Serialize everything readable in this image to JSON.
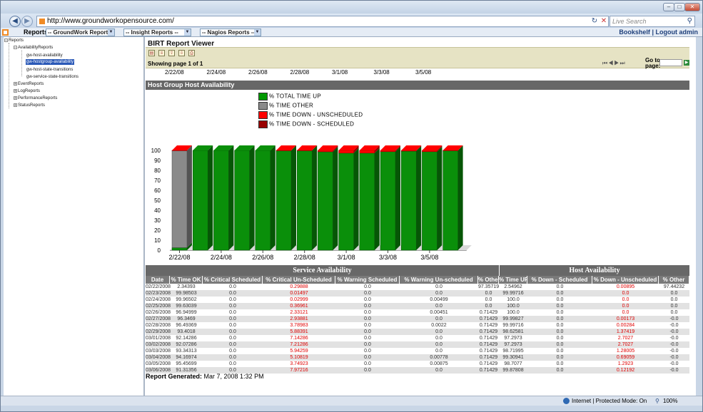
{
  "browser": {
    "url": "http://www.groundworkopensource.com/",
    "search_placeholder": "Live Search",
    "tab_label": "Reports",
    "selects": [
      "-- GroundWork Reports --",
      "-- Insight Reports --",
      "-- Nagios Reports --"
    ],
    "links": {
      "bookshelf": "Bookshelf",
      "separator": "|",
      "logout": "Logout admin"
    },
    "status": {
      "zone": "Internet | Protected Mode: On",
      "zoom": "100%"
    }
  },
  "tree": {
    "root": "Reports",
    "group": "AvailabilityReports",
    "items": [
      "gw-host-availability",
      "gw-hostgroup-availability",
      "gw-host-state-transitions",
      "gw-service-state-transitions"
    ],
    "others": [
      "EventReports",
      "LogReports",
      "PerformanceReports",
      "StatusReports"
    ]
  },
  "birt": {
    "title": "BIRT Report Viewer",
    "showing": "Showing page  1  of  1",
    "goto": "Go to page:"
  },
  "report": {
    "top_ticks": [
      "2/22/08",
      "2/24/08",
      "2/26/08",
      "2/28/08",
      "3/1/08",
      "3/3/08",
      "3/5/08"
    ],
    "section_title": "Host Group Host Availability",
    "legend": [
      {
        "label": "% TOTAL TIME UP",
        "color": "#009900"
      },
      {
        "label": "% TIME OTHER",
        "color": "#8a8a8a"
      },
      {
        "label": "% TIME DOWN - UNSCHEDULED",
        "color": "#ff0000"
      },
      {
        "label": "% TIME DOWN - SCHEDULED",
        "color": "#990000"
      }
    ],
    "generated_label": "Report Generated:",
    "generated_value": "Mar 7, 2008 1:32 PM"
  },
  "chart_data": {
    "type": "bar",
    "categories": [
      "2/22/08",
      "2/23/08",
      "2/24/08",
      "2/25/08",
      "2/26/08",
      "2/27/08",
      "2/28/08",
      "2/29/08",
      "3/1/08",
      "3/2/08",
      "3/3/08",
      "3/4/08",
      "3/5/08",
      "3/6/08"
    ],
    "tick_labels": [
      "2/22/08",
      "2/24/08",
      "2/26/08",
      "2/28/08",
      "3/1/08",
      "3/3/08",
      "3/5/08"
    ],
    "series": [
      {
        "name": "% TOTAL TIME UP",
        "color": "#0a8f0a",
        "values": [
          2.55,
          99.997,
          100,
          100,
          100,
          99.998,
          99.997,
          98.626,
          97.297,
          97.297,
          98.72,
          99.309,
          98.708,
          99.878
        ]
      },
      {
        "name": "% TIME OTHER",
        "color": "#8a8a8a",
        "values": [
          97.44,
          0,
          0,
          0,
          0,
          0,
          0,
          0,
          0,
          0,
          0,
          0,
          0,
          0
        ]
      },
      {
        "name": "% TIME DOWN - UNSCHEDULED",
        "color": "#ff0000",
        "values": [
          0.008,
          0,
          0,
          0,
          0,
          0.002,
          0.003,
          1.374,
          2.703,
          2.703,
          1.28,
          0.69,
          1.292,
          0.122
        ]
      },
      {
        "name": "% TIME DOWN - SCHEDULED",
        "color": "#990000",
        "values": [
          0,
          0,
          0,
          0,
          0,
          0,
          0,
          0,
          0,
          0,
          0,
          0,
          0,
          0
        ]
      }
    ],
    "yticks": [
      0,
      10,
      20,
      30,
      40,
      50,
      60,
      70,
      80,
      90,
      100
    ],
    "ylim": [
      0,
      100
    ],
    "stacked": true,
    "legend_position": "top",
    "grid": false
  },
  "table": {
    "group_headers": [
      "Service Availability",
      "Host Availability"
    ],
    "columns": [
      "Date",
      "% Time OK",
      "% Critical Scheduled",
      "% Critical Un-Scheduled",
      "% Warning Scheduled",
      "% Warning Un-scheduled",
      "% Other",
      "% Time UP",
      "% Down - Scheduled",
      "% Down - Unscheduled",
      "% Other"
    ],
    "rows": [
      [
        "02/22/2008",
        "2.34393",
        "0.0",
        "0.29888",
        "0.0",
        "0.0",
        "97.35719",
        "2.54962",
        "0.0",
        "0.00895",
        "97.44232"
      ],
      [
        "02/23/2008",
        "99.98503",
        "0.0",
        "0.01497",
        "0.0",
        "0.0",
        "0.0",
        "99.99716",
        "0.0",
        "0.0",
        "0.0"
      ],
      [
        "02/24/2008",
        "99.96502",
        "0.0",
        "0.02999",
        "0.0",
        "0.00499",
        "0.0",
        "100.0",
        "0.0",
        "0.0",
        "0.0"
      ],
      [
        "02/25/2008",
        "99.63039",
        "0.0",
        "0.36961",
        "0.0",
        "0.0",
        "0.0",
        "100.0",
        "0.0",
        "0.0",
        "0.0"
      ],
      [
        "02/26/2008",
        "96.94999",
        "0.0",
        "2.33121",
        "0.0",
        "0.00451",
        "0.71429",
        "100.0",
        "0.0",
        "0.0",
        "0.0"
      ],
      [
        "02/27/2008",
        "96.3469",
        "0.0",
        "2.93881",
        "0.0",
        "0.0",
        "0.71429",
        "99.99827",
        "0.0",
        "0.00173",
        "-0.0"
      ],
      [
        "02/28/2008",
        "96.49369",
        "0.0",
        "3.78983",
        "0.0",
        "0.0022",
        "0.71429",
        "99.99716",
        "0.0",
        "0.00284",
        "-0.0"
      ],
      [
        "02/29/2008",
        "93.4018",
        "0.0",
        "5.88391",
        "0.0",
        "0.0",
        "0.71429",
        "98.62581",
        "0.0",
        "1.37419",
        "-0.0"
      ],
      [
        "03/01/2008",
        "92.14286",
        "0.0",
        "7.14286",
        "0.0",
        "0.0",
        "0.71429",
        "97.2973",
        "0.0",
        "2.7027",
        "-0.0"
      ],
      [
        "03/02/2008",
        "92.07286",
        "0.0",
        "7.21286",
        "0.0",
        "0.0",
        "0.71429",
        "97.2973",
        "0.0",
        "2.7027",
        "-0.0"
      ],
      [
        "03/03/2008",
        "93.34313",
        "0.0",
        "5.94259",
        "0.0",
        "0.0",
        "0.71429",
        "98.71995",
        "0.0",
        "1.28005",
        "-0.0"
      ],
      [
        "03/04/2008",
        "94.16974",
        "0.0",
        "5.10819",
        "0.0",
        "0.00778",
        "0.71429",
        "99.30941",
        "0.0",
        "0.69059",
        "-0.0"
      ],
      [
        "03/05/2008",
        "95.45699",
        "0.0",
        "3.74923",
        "0.0",
        "0.00875",
        "0.71429",
        "98.7077",
        "0.0",
        "1.2923",
        "-0.0"
      ],
      [
        "03/06/2008",
        "91.31356",
        "0.0",
        "7.97216",
        "0.0",
        "0.0",
        "0.71429",
        "99.87808",
        "0.0",
        "0.12192",
        "-0.0"
      ]
    ],
    "red_columns": [
      3,
      9
    ]
  }
}
